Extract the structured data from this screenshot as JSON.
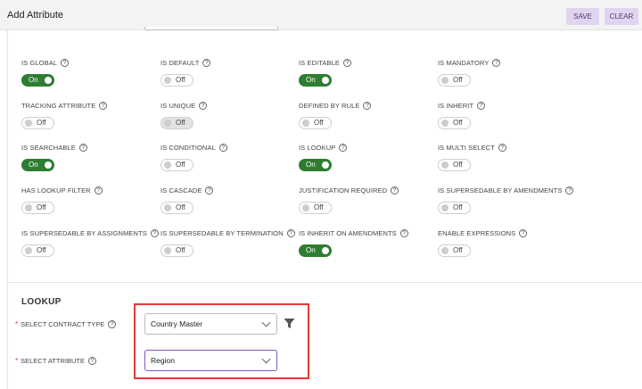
{
  "header": {
    "title": "Add Attribute",
    "save_label": "SAVE",
    "clear_label": "CLEAR"
  },
  "fields": [
    {
      "label": "IS GLOBAL",
      "state": "On"
    },
    {
      "label": "IS DEFAULT",
      "state": "Off"
    },
    {
      "label": "IS EDITABLE",
      "state": "On"
    },
    {
      "label": "IS MANDATORY",
      "state": "Off"
    },
    {
      "label": "TRACKING ATTRIBUTE",
      "state": "Off"
    },
    {
      "label": "IS UNIQUE",
      "state": "Off"
    },
    {
      "label": "DEFINED BY RULE",
      "state": "Off"
    },
    {
      "label": "IS INHERIT",
      "state": "Off"
    },
    {
      "label": "IS SEARCHABLE",
      "state": "On"
    },
    {
      "label": "IS CONDITIONAL",
      "state": "Off"
    },
    {
      "label": "IS LOOKUP",
      "state": "On"
    },
    {
      "label": "IS MULTI SELECT",
      "state": "Off"
    },
    {
      "label": "HAS LOOKUP FILTER",
      "state": "Off"
    },
    {
      "label": "IS CASCADE",
      "state": "Off"
    },
    {
      "label": "JUSTIFICATION REQUIRED",
      "state": "Off"
    },
    {
      "label": "IS SUPERSEDABLE BY AMENDMENTS",
      "state": "Off"
    },
    {
      "label": "IS SUPERSEDABLE BY ASSIGNMENTS",
      "state": "Off"
    },
    {
      "label": "IS SUPERSEDABLE BY TERMINATION",
      "state": "Off"
    },
    {
      "label": "IS INHERIT ON AMENDMENTS",
      "state": "On"
    },
    {
      "label": "ENABLE EXPRESSIONS",
      "state": "Off"
    }
  ],
  "help_glyph": "?",
  "lookup": {
    "section_title": "LOOKUP",
    "required_mark": "*",
    "contract_type_label": "SELECT CONTRACT TYPE",
    "contract_type_value": "Country Master",
    "attribute_label": "SELECT ATTRIBUTE",
    "attribute_value": "Region"
  },
  "icons": {
    "filter": "filter-icon",
    "help": "help-circle-icon",
    "dropdown": "chevron-down-icon"
  },
  "colors": {
    "toggle_on": "#2e7d32",
    "highlight_border": "#e53935",
    "button_bg": "#e0d4f0"
  }
}
